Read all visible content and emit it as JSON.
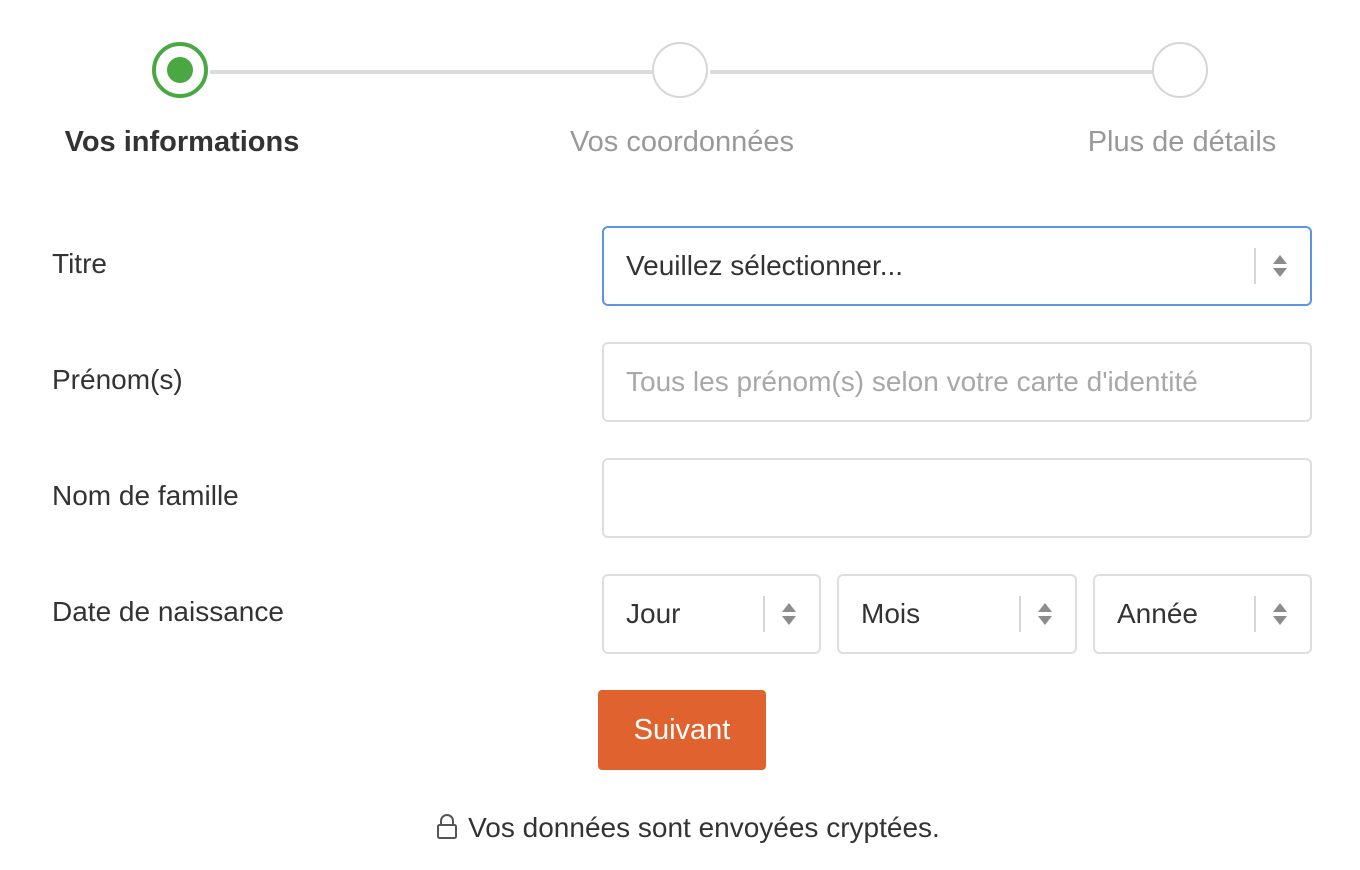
{
  "stepper": {
    "steps": [
      {
        "label": "Vos informations",
        "state": "active"
      },
      {
        "label": "Vos coordonnées",
        "state": "inactive"
      },
      {
        "label": "Plus de détails",
        "state": "inactive"
      }
    ]
  },
  "form": {
    "titre": {
      "label": "Titre",
      "value": "Veuillez sélectionner..."
    },
    "prenom": {
      "label": "Prénom(s)",
      "value": "",
      "placeholder": "Tous les prénom(s) selon votre carte d'identité"
    },
    "nom": {
      "label": "Nom de famille",
      "value": ""
    },
    "naissance": {
      "label": "Date de naissance",
      "jour": "Jour",
      "mois": "Mois",
      "annee": "Année"
    }
  },
  "actions": {
    "next_label": "Suivant"
  },
  "footer": {
    "secure_text": "Vos données sont envoyées cryptées.",
    "icon": "lock-icon"
  },
  "colors": {
    "active_step": "#4aa842",
    "button": "#e0622e",
    "focus_border": "#5a95e6"
  }
}
